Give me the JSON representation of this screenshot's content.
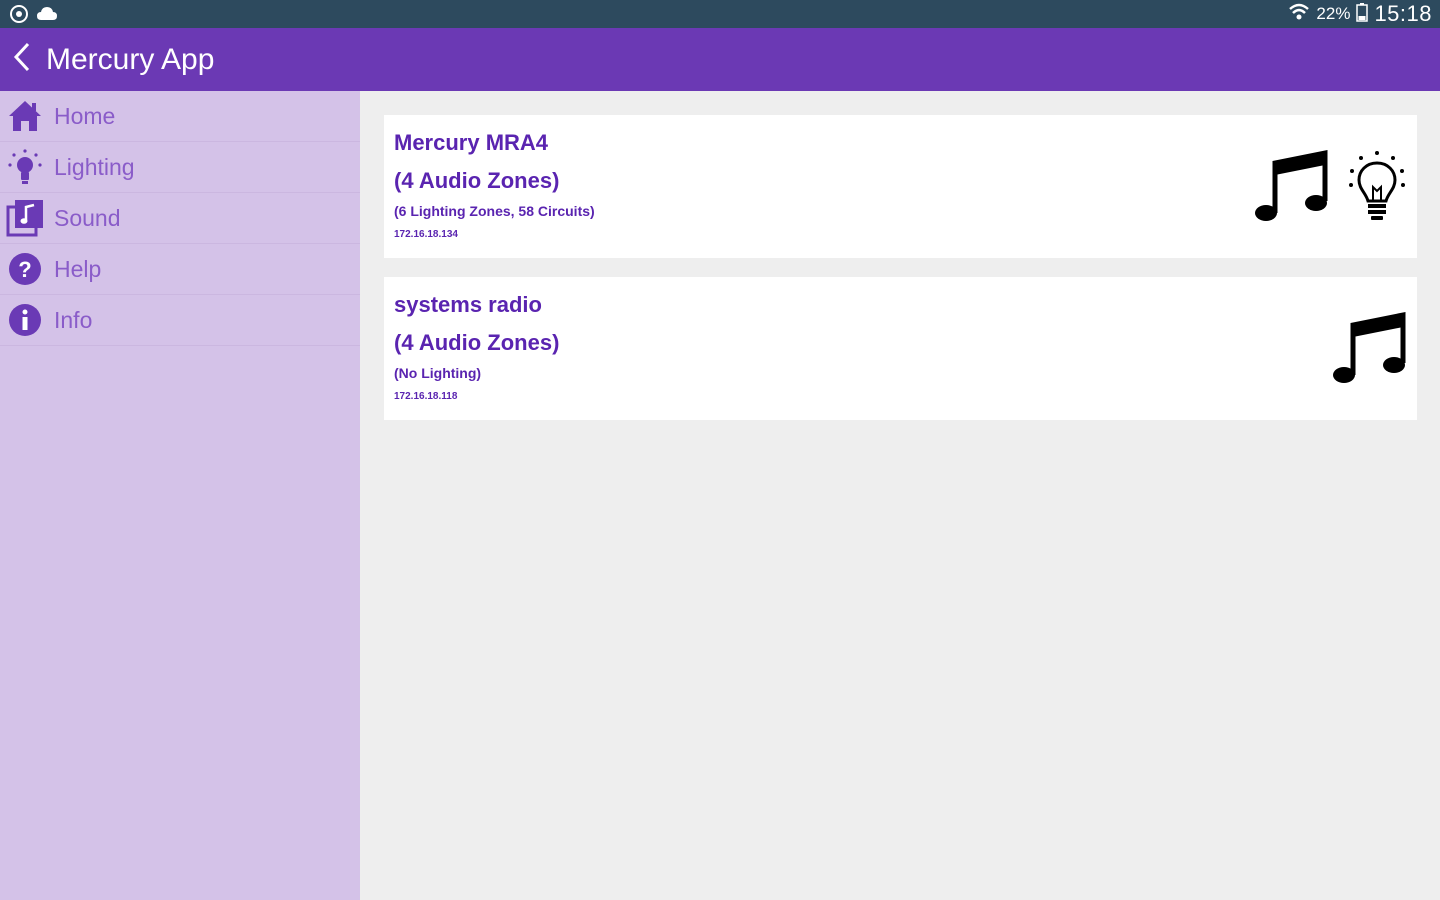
{
  "status_bar": {
    "battery": "22%",
    "time": "15:18",
    "icons": [
      "settings-icon",
      "cloud-icon",
      "wifi-icon",
      "battery-icon"
    ]
  },
  "app_bar": {
    "title": "Mercury App",
    "color": "#6b39b4"
  },
  "sidebar": {
    "items": [
      {
        "label": "Home",
        "icon": "home-icon"
      },
      {
        "label": "Lighting",
        "icon": "lightbulb-icon"
      },
      {
        "label": "Sound",
        "icon": "music-library-icon"
      },
      {
        "label": "Help",
        "icon": "help-icon"
      },
      {
        "label": "Info",
        "icon": "info-icon"
      }
    ]
  },
  "devices": [
    {
      "name": "Mercury MRA4",
      "zones": "(4 Audio Zones)",
      "lighting": "(6 Lighting Zones, 58 Circuits)",
      "ip": "172.16.18.134",
      "icons": [
        "music-note-icon",
        "lightbulb-icon"
      ]
    },
    {
      "name": "systems radio",
      "zones": "(4 Audio Zones)",
      "lighting": "(No Lighting)",
      "ip": "172.16.18.118",
      "icons": [
        "music-note-icon"
      ]
    }
  ],
  "colors": {
    "status_bar": "#2d4a5e",
    "sidebar": "#d4c2e8",
    "accent_text": "#5a24b0",
    "nav_text": "#8a5cc9"
  }
}
